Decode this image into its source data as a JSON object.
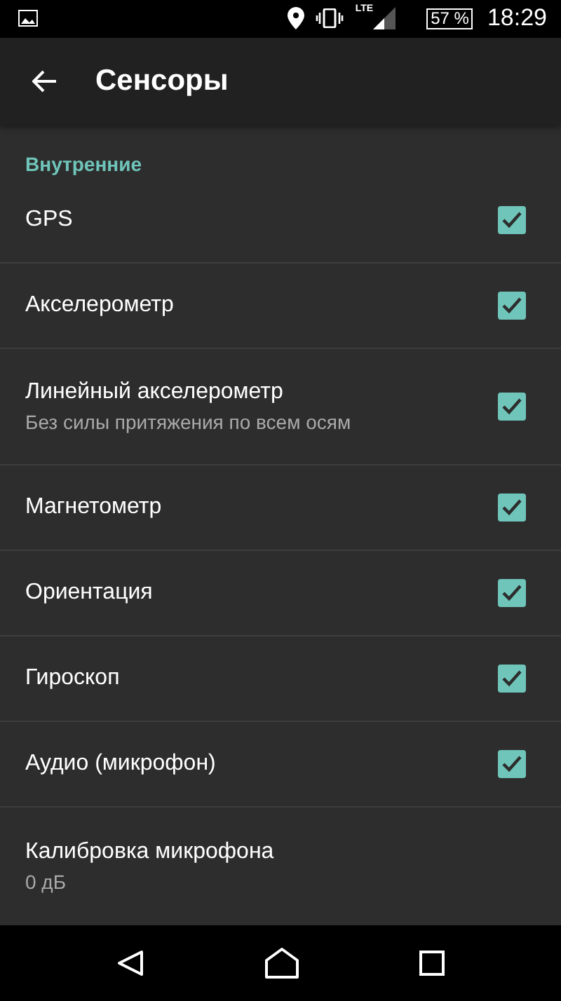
{
  "status_bar": {
    "network": "LTE",
    "battery": "57 %",
    "time": "18:29"
  },
  "toolbar": {
    "title": "Сенсоры"
  },
  "section": {
    "title": "Внутренние"
  },
  "items": [
    {
      "kind": "checkbox",
      "title": "GPS",
      "checked": true
    },
    {
      "kind": "checkbox",
      "title": "Акселерометр",
      "checked": true
    },
    {
      "kind": "checkbox",
      "title": "Линейный акселерометр",
      "summary": "Без силы притяжения по всем осям",
      "checked": true
    },
    {
      "kind": "checkbox",
      "title": "Магнетометр",
      "checked": true
    },
    {
      "kind": "checkbox",
      "title": "Ориентация",
      "checked": true
    },
    {
      "kind": "checkbox",
      "title": "Гироскоп",
      "checked": true
    },
    {
      "kind": "checkbox",
      "title": "Аудио (микрофон)",
      "checked": true
    },
    {
      "kind": "value",
      "title": "Калибровка микрофона",
      "summary": "0 дБ"
    }
  ]
}
